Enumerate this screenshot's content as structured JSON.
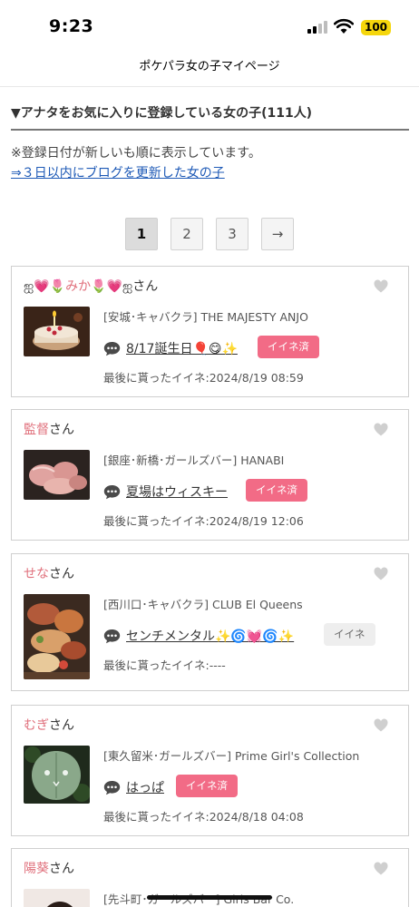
{
  "status_bar": {
    "time": "9:23",
    "battery": "100"
  },
  "page_title": "ポケパラ女の子マイページ",
  "section_heading": "▼アナタをお気に入りに登録している女の子(111人)",
  "sort_note": "※登録日付が新しいも順に表示しています。",
  "blog_link": "⇒３日以内にブログを更新した女の子",
  "pagination": {
    "pages": [
      "1",
      "2",
      "3"
    ],
    "current": "1",
    "next": "→"
  },
  "name_suffix": "さん",
  "last_iine_label": "最後に貰ったイイネ:",
  "favorites": [
    {
      "name": "🌷みか🌷",
      "name_prefix": "ஐ💗",
      "name_postfix": "💗ஐ",
      "shop": "[安城･キャバクラ] THE MAJESTY ANJO",
      "blog_title": "8/17誕生日🎈😋✨",
      "iine_label": "イイネ済",
      "iine_done": true,
      "last_iine": "2024/8/19 08:59"
    },
    {
      "name": "監督",
      "name_prefix": "",
      "name_postfix": "",
      "shop": "[銀座･新橋･ガールズバー] HANABI",
      "blog_title": "夏場はウィスキー",
      "iine_label": "イイネ済",
      "iine_done": true,
      "last_iine": "2024/8/19 12:06"
    },
    {
      "name": "せな",
      "name_prefix": "",
      "name_postfix": "",
      "shop": "[西川口･キャバクラ] CLUB El Queens",
      "blog_title": "センチメンタル✨🌀💓🌀✨",
      "iine_label": "イイネ",
      "iine_done": false,
      "last_iine": "----"
    },
    {
      "name": "むぎ",
      "name_prefix": "",
      "name_postfix": "",
      "shop": "[東久留米･ガールズバー] Prime Girl's Collection",
      "blog_title": "はっぱ",
      "iine_label": "イイネ済",
      "iine_done": true,
      "last_iine": "2024/8/18 04:08"
    },
    {
      "name": "陽葵",
      "name_prefix": "",
      "name_postfix": "",
      "shop": "[先斗町･ガールズバー] Girls Bar Co."
    }
  ],
  "colors": {
    "accent_pink": "#f26b86",
    "name_pink": "#e0707c",
    "link_blue": "#1d59b6",
    "battery_yellow": "#f5d60c"
  },
  "icons": [
    "heart-icon",
    "chat-bubble-icon",
    "signal-icon",
    "wifi-icon",
    "battery-icon"
  ]
}
